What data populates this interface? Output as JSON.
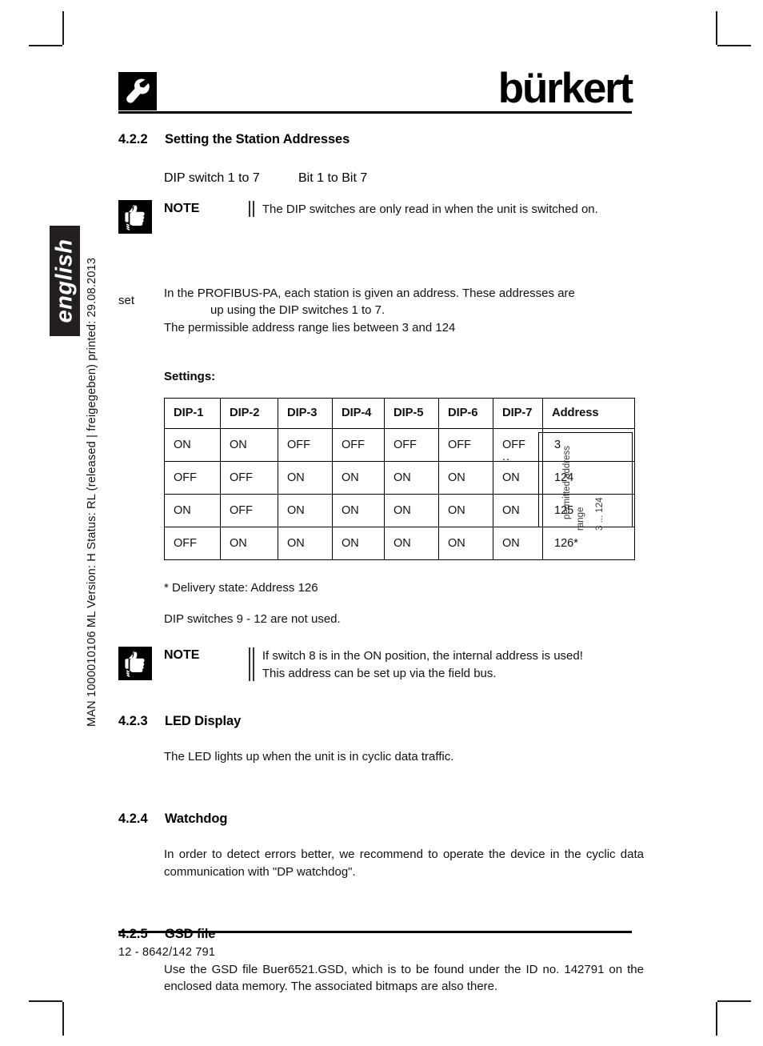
{
  "document": {
    "language_tab": "english",
    "margin_code": "MAN 1000010106  ML  Version: H  Status: RL (released | freigegeben)  printed: 29.08.2013",
    "brand": "bürkert",
    "logo_icon": "wrench-icon"
  },
  "sections": {
    "station_addresses": {
      "number": "4.2.2",
      "title": "Setting the Station Addresses",
      "intro_left": "DIP switch 1 to 7",
      "intro_right": "Bit 1 to Bit 7",
      "note": {
        "label": "NOTE",
        "icon": "thumbs-up-icon",
        "text": "The DIP switches are only read in when the unit is switched on."
      },
      "paragraph_line1": "In the PROFIBUS-PA, each station is given an address. These addresses are",
      "paragraph_stray": "set",
      "paragraph_line2": "up using the DIP switches 1 to 7.",
      "paragraph_line3": "The permissible address range lies between 3 and 124",
      "settings_label": "Settings:",
      "footnote": "*  Delivery state: Address 126",
      "unused_switches": "DIP switches 9 - 12 are not used.",
      "note2": {
        "label": "NOTE",
        "icon": "thumbs-up-icon",
        "line1": "If switch 8 is in the ON position, the internal address is used!",
        "line2": "This address can be set up via the field bus."
      }
    },
    "led_display": {
      "number": "4.2.3",
      "title": "LED Display",
      "body": "The LED lights up when the unit is in cyclic data traffic."
    },
    "watchdog": {
      "number": "4.2.4",
      "title": "Watchdog",
      "body": "In order to detect errors better, we recommend to operate the device in the cyclic data communication with \"DP watchdog\"."
    },
    "gsd_file": {
      "number": "4.2.5",
      "title": "GSD file",
      "body": "Use the GSD file Buer6521.GSD, which is to be found under the ID no. 142791 on the enclosed data memory. The associated bitmaps are also there."
    }
  },
  "dip_table": {
    "headers": [
      "DIP-1",
      "DIP-2",
      "DIP-3",
      "DIP-4",
      "DIP-5",
      "DIP-6",
      "DIP-7",
      "Address"
    ],
    "rows": [
      {
        "cells": [
          "ON",
          "ON",
          "OFF",
          "OFF",
          "OFF",
          "OFF",
          "OFF"
        ],
        "address": "3"
      },
      {
        "cells": [
          "OFF",
          "OFF",
          "ON",
          "ON",
          "ON",
          "ON",
          "ON"
        ],
        "address": "124"
      },
      {
        "cells": [
          "ON",
          "OFF",
          "ON",
          "ON",
          "ON",
          "ON",
          "ON"
        ],
        "address": "125"
      },
      {
        "cells": [
          "OFF",
          "ON",
          "ON",
          "ON",
          "ON",
          "ON",
          "ON"
        ],
        "address": "126*"
      }
    ],
    "continuation_marker": "..",
    "range_label_line1": "permitted  address",
    "range_label_line2": "range",
    "range_label_line3": "3 ... 124"
  },
  "footer": {
    "text": "12  -  8642/142 791"
  }
}
